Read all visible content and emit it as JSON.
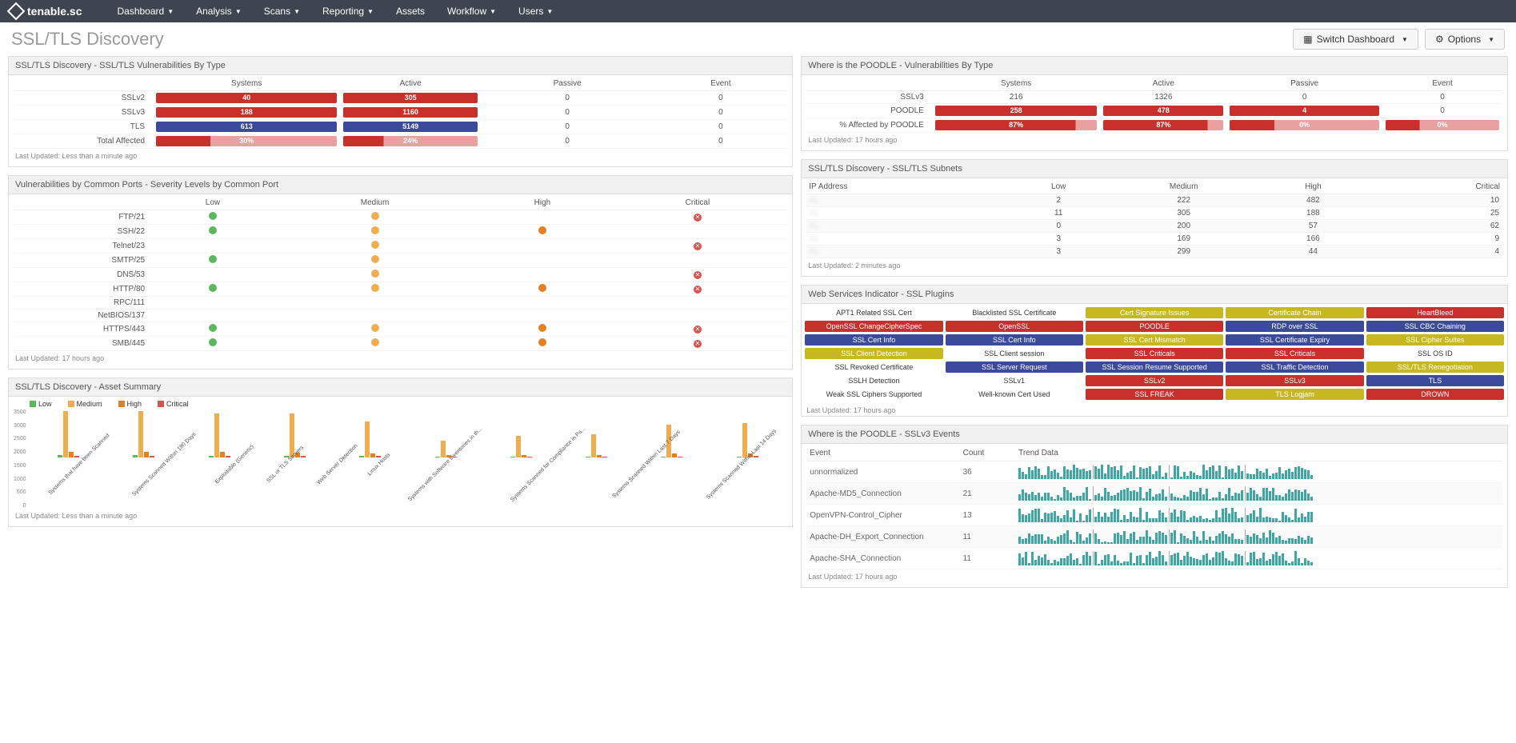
{
  "nav": {
    "brand": "tenable.sc",
    "items": [
      "Dashboard",
      "Analysis",
      "Scans",
      "Reporting",
      "Assets",
      "Workflow",
      "Users"
    ]
  },
  "header": {
    "title": "SSL/TLS Discovery",
    "switch_label": "Switch Dashboard",
    "options_label": "Options"
  },
  "panel_vuln_type": {
    "title": "SSL/TLS Discovery - SSL/TLS Vulnerabilities By Type",
    "cols": [
      "",
      "Systems",
      "Active",
      "Passive",
      "Event"
    ],
    "rows": [
      {
        "label": "SSLv2",
        "systems": "40",
        "active": "305",
        "passive": "0",
        "event": "0",
        "style": "red"
      },
      {
        "label": "SSLv3",
        "systems": "188",
        "active": "1160",
        "passive": "0",
        "event": "0",
        "style": "red"
      },
      {
        "label": "TLS",
        "systems": "613",
        "active": "5149",
        "passive": "0",
        "event": "0",
        "style": "blue"
      },
      {
        "label": "Total Affected",
        "systems": "30%",
        "active": "24%",
        "passive": "0",
        "event": "0",
        "style": "pink",
        "p": "30"
      }
    ],
    "updated": "Last Updated: Less than a minute ago"
  },
  "panel_poodle_type": {
    "title": "Where is the POODLE - Vulnerabilities By Type",
    "cols": [
      "",
      "Systems",
      "Active",
      "Passive",
      "Event"
    ],
    "rows": [
      {
        "label": "SSLv3",
        "systems": "216",
        "active": "1326",
        "passive": "0",
        "event": "0",
        "style": "plain"
      },
      {
        "label": "POODLE",
        "systems": "258",
        "active": "478",
        "passive": "4",
        "event": "0",
        "style": "red"
      },
      {
        "label": "% Affected by POODLE",
        "systems": "87%",
        "active": "87%",
        "passive": "0%",
        "event": "0%",
        "style": "pink",
        "p": "87",
        "allbar": true
      }
    ],
    "updated": "Last Updated: 17 hours ago"
  },
  "panel_ports": {
    "title": "Vulnerabilities by Common Ports - Severity Levels by Common Port",
    "cols": [
      "",
      "Low",
      "Medium",
      "High",
      "Critical"
    ],
    "rows": [
      {
        "l": "FTP/21",
        "low": "g",
        "med": "y",
        "hi": "",
        "crit": "x"
      },
      {
        "l": "SSH/22",
        "low": "g",
        "med": "y",
        "hi": "o",
        "crit": ""
      },
      {
        "l": "Telnet/23",
        "low": "",
        "med": "y",
        "hi": "",
        "crit": "x"
      },
      {
        "l": "SMTP/25",
        "low": "g",
        "med": "y",
        "hi": "",
        "crit": ""
      },
      {
        "l": "DNS/53",
        "low": "",
        "med": "y",
        "hi": "",
        "crit": "x"
      },
      {
        "l": "HTTP/80",
        "low": "g",
        "med": "y",
        "hi": "o",
        "crit": "x"
      },
      {
        "l": "RPC/111",
        "low": "",
        "med": "",
        "hi": "",
        "crit": ""
      },
      {
        "l": "NetBIOS/137",
        "low": "",
        "med": "",
        "hi": "",
        "crit": ""
      },
      {
        "l": "HTTPS/443",
        "low": "g",
        "med": "y",
        "hi": "o",
        "crit": "x"
      },
      {
        "l": "SMB/445",
        "low": "g",
        "med": "y",
        "hi": "o",
        "crit": "x"
      }
    ],
    "updated": "Last Updated: 17 hours ago"
  },
  "panel_subnets": {
    "title": "SSL/TLS Discovery - SSL/TLS Subnets",
    "cols": [
      "IP Address",
      "Low",
      "Medium",
      "High",
      "Critical"
    ],
    "rows": [
      {
        "ip": "—",
        "low": "2",
        "med": "222",
        "hi": "482",
        "crit": "10"
      },
      {
        "ip": "—",
        "low": "11",
        "med": "305",
        "hi": "188",
        "crit": "25"
      },
      {
        "ip": "—",
        "low": "0",
        "med": "200",
        "hi": "57",
        "crit": "62"
      },
      {
        "ip": "—",
        "low": "3",
        "med": "169",
        "hi": "166",
        "crit": "9"
      },
      {
        "ip": "—",
        "low": "3",
        "med": "299",
        "hi": "44",
        "crit": "4"
      }
    ],
    "updated": "Last Updated: 2 minutes ago"
  },
  "panel_asset": {
    "title": "SSL/TLS Discovery - Asset Summary",
    "legend": {
      "low": "Low",
      "med": "Medium",
      "high": "High",
      "crit": "Critical"
    },
    "yticks": [
      "3500",
      "3000",
      "2500",
      "2000",
      "1500",
      "1000",
      "500",
      "0"
    ],
    "cats": [
      "Systems that have been Scanned",
      "Systems Scanned Within 180 Days",
      "Exploitable (Generic)",
      "SSL or TLS Servers",
      "Web Server Detection",
      "Linux Hosts",
      "Systems with Software Inventories in th...",
      "Systems Scanned for Compliance in Pa...",
      "Systems Scanned Within Last 7 Days",
      "Systems Scanned Within Last 14 Days"
    ],
    "updated": "Last Updated: Less than a minute ago"
  },
  "chart_data": {
    "type": "bar",
    "title": "SSL/TLS Discovery - Asset Summary",
    "xlabel": "",
    "ylabel": "",
    "ylim": [
      0,
      3500
    ],
    "categories": [
      "Systems that have been Scanned",
      "Systems Scanned Within 180 Days",
      "Exploitable (Generic)",
      "SSL or TLS Servers",
      "Web Server Detection",
      "Linux Hosts",
      "Systems with Software Inventories",
      "Systems Scanned for Compliance",
      "Systems Scanned Within Last 7 Days",
      "Systems Scanned Within Last 14 Days"
    ],
    "series": [
      {
        "name": "Low",
        "color": "#5cb85c",
        "values": [
          200,
          200,
          100,
          100,
          100,
          50,
          50,
          50,
          60,
          80
        ]
      },
      {
        "name": "Medium",
        "color": "#f0ad4e",
        "values": [
          3400,
          3400,
          3200,
          3200,
          2600,
          1200,
          1600,
          1700,
          2400,
          2500
        ]
      },
      {
        "name": "High",
        "color": "#e67e22",
        "values": [
          400,
          400,
          400,
          350,
          300,
          150,
          200,
          200,
          280,
          300
        ]
      },
      {
        "name": "Critical",
        "color": "#d9534f",
        "values": [
          120,
          120,
          120,
          100,
          90,
          40,
          60,
          60,
          80,
          90
        ]
      }
    ]
  },
  "panel_plugins": {
    "title": "Web Services Indicator - SSL Plugins",
    "grid": [
      [
        {
          "t": "APT1 Related SSL Cert",
          "c": "wht"
        },
        {
          "t": "Blacklisted SSL Certificate",
          "c": "wht"
        },
        {
          "t": "Cert Signature Issues",
          "c": "yel"
        },
        {
          "t": "Certificate Chain",
          "c": "yel"
        },
        {
          "t": "HeartBleed",
          "c": "red"
        }
      ],
      [
        {
          "t": "OpenSSL ChangeCipherSpec",
          "c": "red"
        },
        {
          "t": "OpenSSL",
          "c": "red"
        },
        {
          "t": "POODLE",
          "c": "red"
        },
        {
          "t": "RDP over SSL",
          "c": "blue"
        },
        {
          "t": "SSL CBC Chaining",
          "c": "blue"
        }
      ],
      [
        {
          "t": "SSL Cert Info",
          "c": "blue"
        },
        {
          "t": "SSL Cert Info",
          "c": "blue"
        },
        {
          "t": "SSL Cert Mismatch",
          "c": "yel"
        },
        {
          "t": "SSL Certificate Expiry",
          "c": "blue"
        },
        {
          "t": "SSL Cipher Suites",
          "c": "yel"
        }
      ],
      [
        {
          "t": "SSL Client Detection",
          "c": "yel"
        },
        {
          "t": "SSL Client session",
          "c": "wht"
        },
        {
          "t": "SSL Criticals",
          "c": "red"
        },
        {
          "t": "SSL Criticals",
          "c": "red"
        },
        {
          "t": "SSL OS ID",
          "c": "wht"
        }
      ],
      [
        {
          "t": "SSL Revoked Certificate",
          "c": "wht"
        },
        {
          "t": "SSL Server Request",
          "c": "blue"
        },
        {
          "t": "SSL Session Resume Supported",
          "c": "blue"
        },
        {
          "t": "SSL Traffic Detection",
          "c": "blue"
        },
        {
          "t": "SSL/TLS Renegotiation",
          "c": "yel"
        }
      ],
      [
        {
          "t": "SSLH Detection",
          "c": "wht"
        },
        {
          "t": "SSLv1",
          "c": "wht"
        },
        {
          "t": "SSLv2",
          "c": "red"
        },
        {
          "t": "SSLv3",
          "c": "red"
        },
        {
          "t": "TLS",
          "c": "blue"
        }
      ],
      [
        {
          "t": "Weak SSL Ciphers Supported",
          "c": "wht"
        },
        {
          "t": "Well-known Cert Used",
          "c": "wht"
        },
        {
          "t": "SSL FREAK",
          "c": "red"
        },
        {
          "t": "TLS Logjam",
          "c": "yel"
        },
        {
          "t": "DROWN",
          "c": "red"
        }
      ]
    ],
    "updated": "Last Updated: 17 hours ago"
  },
  "panel_events": {
    "title": "Where is the POODLE - SSLv3 Events",
    "cols": [
      "Event",
      "Count",
      "Trend Data"
    ],
    "rows": [
      {
        "ev": "unnormalized",
        "ct": "36"
      },
      {
        "ev": "Apache-MD5_Connection",
        "ct": "21"
      },
      {
        "ev": "OpenVPN-Control_Cipher",
        "ct": "13"
      },
      {
        "ev": "Apache-DH_Export_Connection",
        "ct": "11"
      },
      {
        "ev": "Apache-SHA_Connection",
        "ct": "11"
      }
    ],
    "updated": "Last Updated: 17 hours ago"
  }
}
